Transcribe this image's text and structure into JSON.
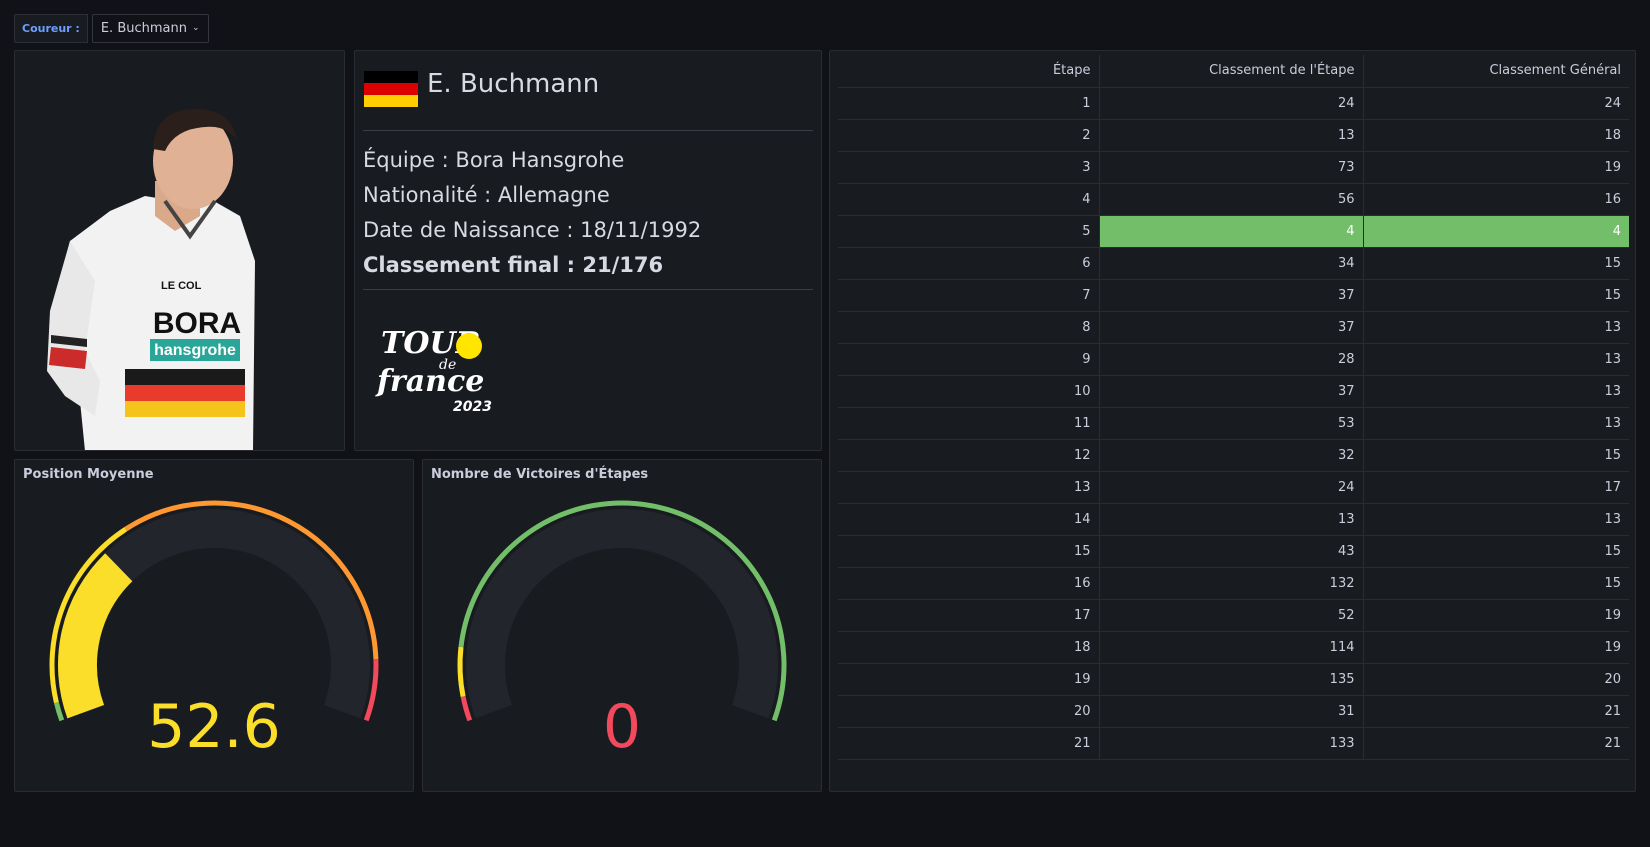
{
  "variable": {
    "label": "Coureur :",
    "value": "E. Buchmann"
  },
  "rider": {
    "name": "E. Buchmann",
    "flag_colors": [
      "#000000",
      "#dd0000",
      "#ffce00"
    ],
    "team_line": "Équipe : Bora Hansgrohe",
    "nationality_line": "Nationalité : Allemagne",
    "birth_line": "Date de Naissance : 18/11/1992",
    "final_line": "Classement final : 21/176",
    "jersey_text": {
      "sponsor1": "BORA",
      "sponsor2": "hansgrohe",
      "sponsor3": "LE COL"
    }
  },
  "logo": {
    "line1": "TOUR",
    "line2": "de",
    "line3": "france",
    "year": "2023"
  },
  "gauge_avg": {
    "title": "Position Moyenne",
    "value": "52.6",
    "value_num": 52.6,
    "min": 0,
    "max": 176,
    "value_color": "#fade2a"
  },
  "gauge_wins": {
    "title": "Nombre de Victoires d'Étapes",
    "value": "0",
    "value_num": 0,
    "value_color": "#f2495c"
  },
  "table": {
    "headers": [
      "Étape",
      "Classement de l'Étape",
      "Classement Général"
    ],
    "highlight_color": "#73bf69",
    "rows": [
      [
        "1",
        "24",
        "24"
      ],
      [
        "2",
        "13",
        "18"
      ],
      [
        "3",
        "73",
        "19"
      ],
      [
        "4",
        "56",
        "16"
      ],
      [
        "5",
        "4",
        "4"
      ],
      [
        "6",
        "34",
        "15"
      ],
      [
        "7",
        "37",
        "15"
      ],
      [
        "8",
        "37",
        "13"
      ],
      [
        "9",
        "28",
        "13"
      ],
      [
        "10",
        "37",
        "13"
      ],
      [
        "11",
        "53",
        "13"
      ],
      [
        "12",
        "32",
        "15"
      ],
      [
        "13",
        "24",
        "17"
      ],
      [
        "14",
        "13",
        "13"
      ],
      [
        "15",
        "43",
        "15"
      ],
      [
        "16",
        "132",
        "15"
      ],
      [
        "17",
        "52",
        "19"
      ],
      [
        "18",
        "114",
        "19"
      ],
      [
        "19",
        "135",
        "20"
      ],
      [
        "20",
        "31",
        "21"
      ],
      [
        "21",
        "133",
        "21"
      ]
    ]
  }
}
